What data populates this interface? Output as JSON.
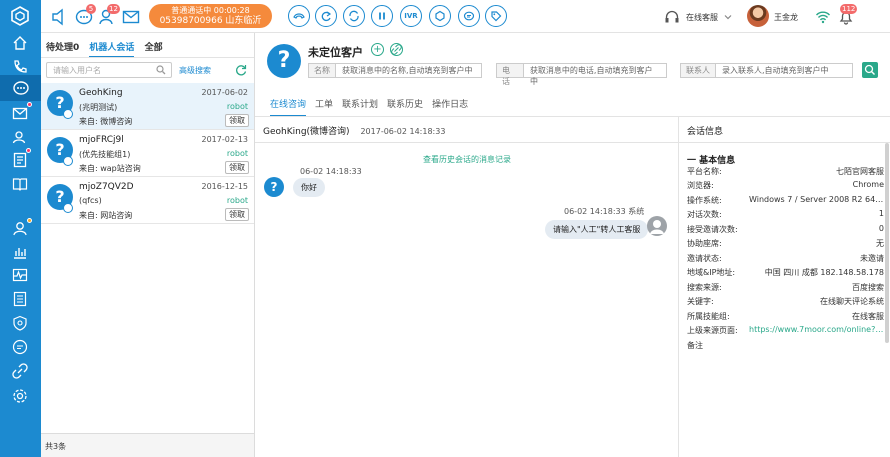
{
  "top": {
    "badges": {
      "chat": "5",
      "users": "12",
      "notify": "112"
    },
    "call": {
      "line1": "普通通话中 00:00:28",
      "line2": "05398700966 山东临沂"
    },
    "controls": {
      "ivr": "IVR"
    },
    "status": "在线客服",
    "user": "王金龙"
  },
  "left": {
    "tabs": [
      "待处理0",
      "机器人会话",
      "全部"
    ],
    "search_placeholder": "请输入用户名",
    "advanced": "高级搜索",
    "sessions": [
      {
        "name": "GeohKing",
        "group": "(兆明测试)",
        "from": "来自: 微博咨询",
        "date": "2017-06-02",
        "tag": "robot",
        "button": "领取"
      },
      {
        "name": "mjoFRCj9l",
        "group": "(优先技能组1)",
        "from": "来自: wap站咨询",
        "date": "2017-02-13",
        "tag": "robot",
        "button": "领取"
      },
      {
        "name": "mjoZ7QV2D",
        "group": "(qfcs)",
        "from": "来自: 网站咨询",
        "date": "2016-12-15",
        "tag": "robot",
        "button": "领取"
      }
    ],
    "footer": "共3条"
  },
  "customer": {
    "name": "未定位客户",
    "fields": [
      {
        "label": "名称",
        "placeholder": "获取消息中的名称,自动填充到客户中"
      },
      {
        "label": "电话",
        "placeholder": "获取消息中的电话,自动填充到客户中"
      },
      {
        "label": "联系人",
        "placeholder": "录入联系人,自动填充到客户中"
      }
    ]
  },
  "main_tabs": [
    "在线咨询",
    "工单",
    "联系计划",
    "联系历史",
    "操作日志"
  ],
  "chat": {
    "header": "GeohKing(微博咨询)",
    "header_time": "2017-06-02 14:18:33",
    "history_link": "查看历史会话的消息记录",
    "messages": [
      {
        "time": "06-02 14:18:33",
        "text": "你好"
      },
      {
        "time": "06-02 14:18:33 系统",
        "text": "请输入\"人工\"转人工客服"
      }
    ]
  },
  "info": {
    "title": "会话信息",
    "section": "一 基本信息",
    "rows": [
      {
        "k": "平台名称:",
        "v": "七陌官网客服"
      },
      {
        "k": "浏览器:",
        "v": "Chrome"
      },
      {
        "k": "操作系统:",
        "v": "Windows 7 / Server 2008 R2 64-bit"
      },
      {
        "k": "对话次数:",
        "v": "1"
      },
      {
        "k": "接受邀请次数:",
        "v": "0"
      },
      {
        "k": "协助座席:",
        "v": "无"
      },
      {
        "k": "邀请状态:",
        "v": "未邀请"
      },
      {
        "k": "地域&IP地址:",
        "v": "中国 四川 成都 182.148.58.178"
      },
      {
        "k": "搜索来源:",
        "v": "百度搜索"
      },
      {
        "k": "关键字:",
        "v": "在线聊天评论系统"
      },
      {
        "k": "所属技能组:",
        "v": "在线客服"
      },
      {
        "k": "上级来源页面:",
        "v": "https://www.7moor.com/online?sourc..."
      },
      {
        "k": "备注",
        "v": ""
      }
    ]
  }
}
